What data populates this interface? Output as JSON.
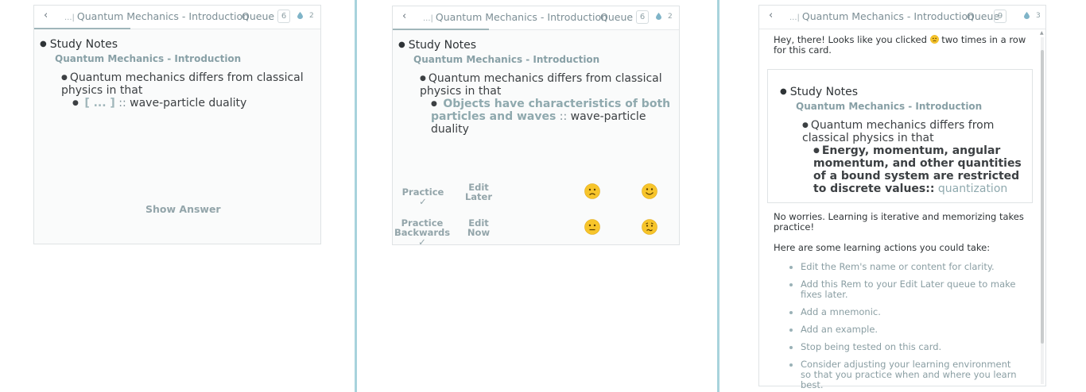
{
  "panels": [
    {
      "topbar": {
        "back": "‹",
        "crumb_dots": "...|",
        "crumb": "Quantum Mechanics - Introduction",
        "queue_label": "Queue",
        "queue_count": "6",
        "drop_count": "2",
        "progress": 0.33
      },
      "study_notes": "Study Notes",
      "doc_title": "Quantum Mechanics - Introduction",
      "line1": "Quantum mechanics differs from classical",
      "line2": "physics in that",
      "cloze": "[ ... ]",
      "separator": "::",
      "back_text": "wave-particle duality",
      "show_answer": "Show Answer"
    },
    {
      "topbar": {
        "back": "‹",
        "crumb_dots": "...|",
        "crumb": "Quantum Mechanics - Introduction",
        "queue_label": "Queue",
        "queue_count": "6",
        "drop_count": "2",
        "progress": 0.33
      },
      "study_notes": "Study Notes",
      "doc_title": "Quantum Mechanics - Introduction",
      "line1": "Quantum mechanics differs from classical",
      "line2": "physics in that",
      "answer_line1": "Objects have characteristics of both",
      "answer_line2": "particles and waves",
      "separator": "::",
      "back_text": "wave-particle duality",
      "actions": {
        "practice": "Practice ✓",
        "edit_later_1": "Edit",
        "edit_later_2": "Later",
        "practice_backwards_1": "Practice",
        "practice_backwards_2": "Backwards ✓",
        "edit_now_1": "Edit",
        "edit_now_2": "Now"
      },
      "emoji_names": [
        "frown-face-icon",
        "smile-face-icon",
        "neutral-face-icon",
        "worried-face-icon"
      ]
    },
    {
      "topbar": {
        "back": "‹",
        "crumb_dots": "...|",
        "crumb": "Quantum Mechanics - Introduction",
        "queue_label": "Queue",
        "queue_count": "9",
        "drop_count": "3"
      },
      "hey_line1_a": "Hey, there! Looks like you clicked",
      "hey_line1_b": "two times in a row",
      "hey_line2": "for this card.",
      "study_notes": "Study Notes",
      "doc_title": "Quantum Mechanics - Introduction",
      "line1": "Quantum mechanics differs from",
      "line2": "classical physics in that",
      "answer_lines": [
        "Energy, momentum, angular",
        "momentum, and other quantities",
        "of a bound system are restricted"
      ],
      "answer_last": "to discrete values::",
      "back_text": "quantization",
      "no_worries_1": "No worries. Learning is iterative and memorizing takes",
      "no_worries_2": "practice!",
      "actions_intro": "Here are some learning actions you could take:",
      "suggestions": [
        "Edit the Rem's name or content for clarity.",
        "Add this Rem to your Edit Later queue to make fixes later.",
        "Add a mnemonic.",
        "Add an example.",
        "Stop being tested on this card.",
        "Consider adjusting your learning environment so that you practice when and where you learn best."
      ]
    }
  ],
  "colors": {
    "divider": "#a8d3dc",
    "accent": "#8fa9ae",
    "emoji_yellow": "#f7c52b"
  }
}
